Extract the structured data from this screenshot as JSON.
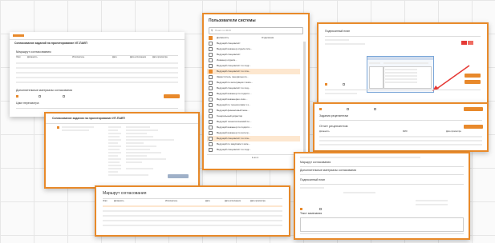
{
  "users_panel": {
    "title": "Пользователи системы",
    "search_placeholder": "Поиск по ФИО",
    "col_position": "Должность",
    "col_unit": "Отделение",
    "rows": [
      {
        "position": "Ведущий специалист",
        "unit": "",
        "checked": false,
        "selected": false
      },
      {
        "position": "Ведущий инженер отдела пла...",
        "unit": "",
        "checked": false,
        "selected": false
      },
      {
        "position": "Ведущий специалист",
        "unit": "",
        "checked": false,
        "selected": false
      },
      {
        "position": "Инженер отдела...",
        "unit": "",
        "checked": false,
        "selected": false
      },
      {
        "position": "Ведущий специалист по подг...",
        "unit": "",
        "checked": false,
        "selected": false
      },
      {
        "position": "Ведущий специалист по пла...",
        "unit": "",
        "checked": true,
        "selected": true
      },
      {
        "position": "Заместитель генерального...",
        "unit": "",
        "checked": false,
        "selected": false
      },
      {
        "position": "Ведущий по интеграции 1 кате...",
        "unit": "",
        "checked": false,
        "selected": false
      },
      {
        "position": "Ведущий специалист по под...",
        "unit": "",
        "checked": false,
        "selected": false
      },
      {
        "position": "Ведущий инженер по подгото...",
        "unit": "",
        "checked": false,
        "selected": false
      },
      {
        "position": "Ведущий инженерно-техн...",
        "unit": "",
        "checked": false,
        "selected": false
      },
      {
        "position": "Ведущий по технологиям 1 к...",
        "unit": "",
        "checked": false,
        "selected": false
      },
      {
        "position": "Ведущий финансовый экон...",
        "unit": "",
        "checked": false,
        "selected": false
      },
      {
        "position": "Генеральный директор",
        "unit": "",
        "checked": false,
        "selected": false
      },
      {
        "position": "Ведущий технологический по...",
        "unit": "",
        "checked": false,
        "selected": false
      },
      {
        "position": "Ведущий инженер по подгото...",
        "unit": "",
        "checked": false,
        "selected": false
      },
      {
        "position": "Ведущий инженер по интегр...",
        "unit": "",
        "checked": false,
        "selected": false
      },
      {
        "position": "Ведущий специалист по пла...",
        "unit": "",
        "checked": false,
        "selected": true
      },
      {
        "position": "Ведущий по закупкам 1 кате...",
        "unit": "",
        "checked": false,
        "selected": false
      },
      {
        "position": "Ведущий специалист по подг...",
        "unit": "",
        "checked": false,
        "selected": false
      }
    ],
    "pagination": "1 из 1",
    "footer_left": "",
    "footer_right": "",
    "accent": "#e8892b"
  },
  "card1": {
    "title": "Согласование заданий на проектирование ИТ-ПАЕП",
    "section": "Маршрут согласования",
    "cols": [
      "Этап",
      "Должность",
      "Исполнитель",
      "Дата",
      "Дата исполнения",
      "Дата просмотра"
    ],
    "rows": 5,
    "section2": "Дополнительные материалы согласования",
    "section3": "Цикл пересмотра",
    "button": ""
  },
  "card2": {
    "title": "Согласование задания на проектирование ИТ-ПАЕП",
    "lines": 18
  },
  "card3": {
    "title": "Маршрут согласования",
    "cols": [
      "Этап",
      "Должность",
      "Исполнитель",
      "Дата",
      "Дата исполнения",
      "Дата просмотра"
    ],
    "rows": 5
  },
  "card4": {
    "title": "Подписанный план",
    "dialog_title": ""
  },
  "card5": {
    "title": "Задания рецензентам",
    "section": "Отчет рецензентов",
    "cols": [
      "Должность",
      "ФИО",
      "Дата просмотра"
    ],
    "rows": 3,
    "button": ""
  },
  "card6": {
    "title": "Маршрут согласования",
    "section2": "Дополнительные материалы согласования",
    "section3": "Подписанный план",
    "section4": "Текст замечания"
  }
}
